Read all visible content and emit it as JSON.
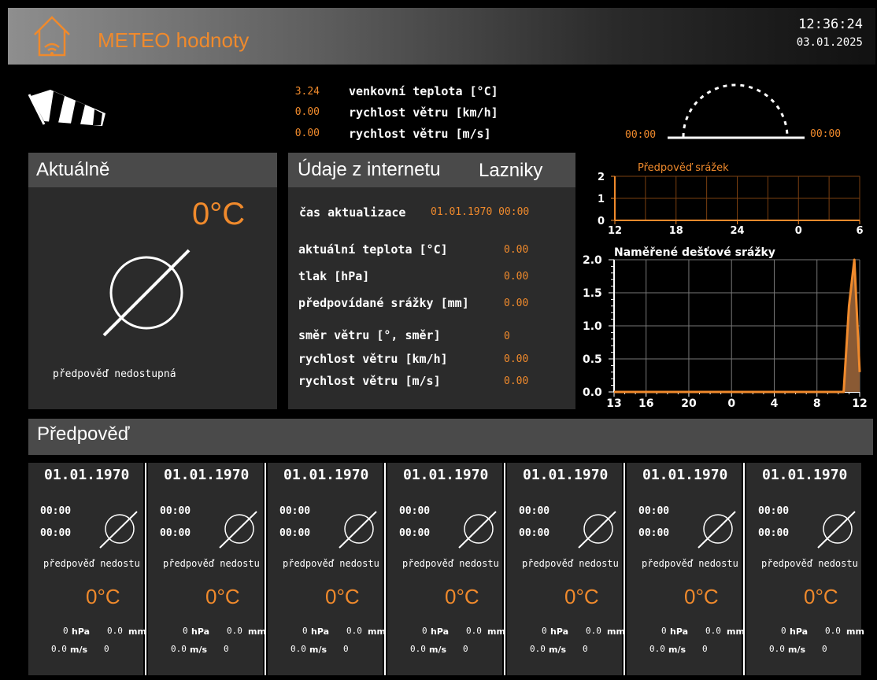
{
  "header": {
    "title": "METEO hodnoty",
    "time": "12:36:24",
    "date": "03.01.2025",
    "home_icon": "home-wifi-icon"
  },
  "top": {
    "windsock_icon": "windsock-icon",
    "rows": [
      {
        "value": "3.24",
        "label": "venkovní teplota [°C]"
      },
      {
        "value": "0.00",
        "label": "rychlost větru [km/h]"
      },
      {
        "value": "0.00",
        "label": "rychlost větru [m/s]"
      }
    ],
    "sun": {
      "rise": "00:00",
      "set": "00:00",
      "icon": "sun-arc-icon"
    }
  },
  "current": {
    "title": "Aktuálně",
    "temp": "0°C",
    "icon": "no-data-icon",
    "desc": "předpověď nedostupná"
  },
  "internet": {
    "title": "Údaje z internetu",
    "location": "Lazniky",
    "update_label": "čas aktualizace",
    "update_value": "01.01.1970 00:00",
    "rows": [
      {
        "label": "aktuální teplota [°C]",
        "value": "0.00"
      },
      {
        "label": "tlak [hPa]",
        "value": "0.00"
      },
      {
        "label": "předpovídané srážky [mm]",
        "value": "0.00"
      },
      {
        "label": "směr větru [°, směr]",
        "value": "0"
      },
      {
        "label": "rychlost větru [km/h]",
        "value": "0.00"
      },
      {
        "label": "rychlost větru [m/s]",
        "value": "0.00"
      }
    ]
  },
  "colors": {
    "accent": "#f08a2c",
    "panel": "#2b2b2b",
    "panel_head": "#4a4a4a"
  },
  "chart_data": [
    {
      "type": "line",
      "title": "Předpověď srážek",
      "x": [
        "12",
        "18",
        "24",
        "0",
        "6"
      ],
      "ylim": [
        0,
        2
      ],
      "yticks": [
        "0",
        "1",
        "2"
      ],
      "series": [
        {
          "values": [
            0,
            0,
            0,
            0,
            0
          ]
        }
      ],
      "grid": true
    },
    {
      "type": "area",
      "title": "Naměřené dešťové srážky",
      "x": [
        "13",
        "16",
        "20",
        "0",
        "4",
        "8",
        "12"
      ],
      "ylim": [
        0,
        2.0
      ],
      "yticks": [
        "0.0",
        "0.5",
        "1.0",
        "1.5",
        "2.0"
      ],
      "series": [
        {
          "x": [
            13,
            16,
            20,
            24,
            28,
            32,
            34.5,
            35,
            35.5,
            36
          ],
          "values": [
            0,
            0,
            0,
            0,
            0,
            0,
            0,
            1.3,
            2.0,
            0.3
          ]
        }
      ],
      "grid": true
    }
  ],
  "forecast": {
    "title": "Předpověď",
    "cards": [
      {
        "date": "01.01.1970",
        "t1": "00:00",
        "t2": "00:00",
        "desc": "předpověď nedostupná",
        "temp": "0°C",
        "hpa": "0",
        "hpa_unit": "hPa",
        "mm": "0.0",
        "mm_unit": "mm",
        "ms": "0.0",
        "ms_unit": "m/s",
        "dir": "0"
      },
      {
        "date": "01.01.1970",
        "t1": "00:00",
        "t2": "00:00",
        "desc": "předpověď nedostupná",
        "temp": "0°C",
        "hpa": "0",
        "hpa_unit": "hPa",
        "mm": "0.0",
        "mm_unit": "mm",
        "ms": "0.0",
        "ms_unit": "m/s",
        "dir": "0"
      },
      {
        "date": "01.01.1970",
        "t1": "00:00",
        "t2": "00:00",
        "desc": "předpověď nedostupná",
        "temp": "0°C",
        "hpa": "0",
        "hpa_unit": "hPa",
        "mm": "0.0",
        "mm_unit": "mm",
        "ms": "0.0",
        "ms_unit": "m/s",
        "dir": "0"
      },
      {
        "date": "01.01.1970",
        "t1": "00:00",
        "t2": "00:00",
        "desc": "předpověď nedostupná",
        "temp": "0°C",
        "hpa": "0",
        "hpa_unit": "hPa",
        "mm": "0.0",
        "mm_unit": "mm",
        "ms": "0.0",
        "ms_unit": "m/s",
        "dir": "0"
      },
      {
        "date": "01.01.1970",
        "t1": "00:00",
        "t2": "00:00",
        "desc": "předpověď nedostupná",
        "temp": "0°C",
        "hpa": "0",
        "hpa_unit": "hPa",
        "mm": "0.0",
        "mm_unit": "mm",
        "ms": "0.0",
        "ms_unit": "m/s",
        "dir": "0"
      },
      {
        "date": "01.01.1970",
        "t1": "00:00",
        "t2": "00:00",
        "desc": "předpověď nedostupná",
        "temp": "0°C",
        "hpa": "0",
        "hpa_unit": "hPa",
        "mm": "0.0",
        "mm_unit": "mm",
        "ms": "0.0",
        "ms_unit": "m/s",
        "dir": "0"
      },
      {
        "date": "01.01.1970",
        "t1": "00:00",
        "t2": "00:00",
        "desc": "předpověď nedostupná",
        "temp": "0°C",
        "hpa": "0",
        "hpa_unit": "hPa",
        "mm": "0.0",
        "mm_unit": "mm",
        "ms": "0.0",
        "ms_unit": "m/s",
        "dir": "0"
      }
    ]
  }
}
